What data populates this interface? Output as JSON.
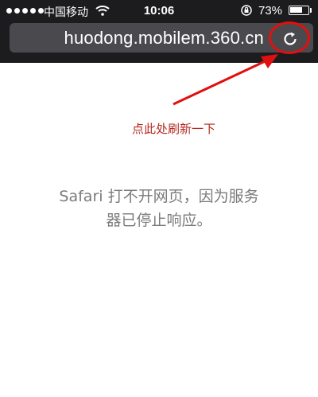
{
  "status_bar": {
    "carrier": "中国移动",
    "time": "10:06",
    "battery_percent": "73%",
    "battery_level": 0.73,
    "signal_bars": 5
  },
  "browser": {
    "url": "huodong.mobilem.360.cn",
    "reload_icon": "reload-icon"
  },
  "annotation": {
    "note": "点此处刷新一下",
    "color": "#e01010"
  },
  "page": {
    "error_line1": "Safari 打不开网页，因为服务",
    "error_line2": "器已停止响应。"
  }
}
